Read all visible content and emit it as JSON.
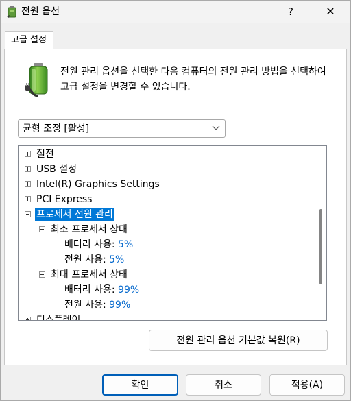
{
  "window": {
    "title": "전원 옵션",
    "help_glyph": "?",
    "close_glyph": "✕"
  },
  "tab": {
    "label": "고급 설정"
  },
  "description": "전원 관리 옵션을 선택한 다음 컴퓨터의 전원 관리 방법을 선택하여 고급 설정을 변경할 수 있습니다.",
  "plan_select": {
    "selected": "균형 조정 [활성]"
  },
  "tree": {
    "items": [
      {
        "label": "절전",
        "expander": "plus"
      },
      {
        "label": "USB 설정",
        "expander": "plus"
      },
      {
        "label": "Intel(R) Graphics Settings",
        "expander": "plus"
      },
      {
        "label": "PCI Express",
        "expander": "plus"
      },
      {
        "label": "프로세서 전원 관리",
        "expander": "minus",
        "selected": true
      },
      {
        "label": "최소 프로세서 상태",
        "expander": "minus"
      },
      {
        "label": "배터리 사용:",
        "value": "5%"
      },
      {
        "label": "전원 사용:",
        "value": "5%"
      },
      {
        "label": "최대 프로세서 상태",
        "expander": "minus"
      },
      {
        "label": "배터리 사용:",
        "value": "99%"
      },
      {
        "label": "전원 사용:",
        "value": "99%"
      },
      {
        "label": "디스플레이",
        "expander": "plus"
      }
    ]
  },
  "buttons": {
    "restore_defaults": "전원 관리 옵션 기본값 복원(R)",
    "ok": "확인",
    "cancel": "취소",
    "apply": "적용(A)"
  },
  "colors": {
    "selection": "#0078d7",
    "value_link": "#0066cc",
    "default_button_border": "#005fb8"
  }
}
